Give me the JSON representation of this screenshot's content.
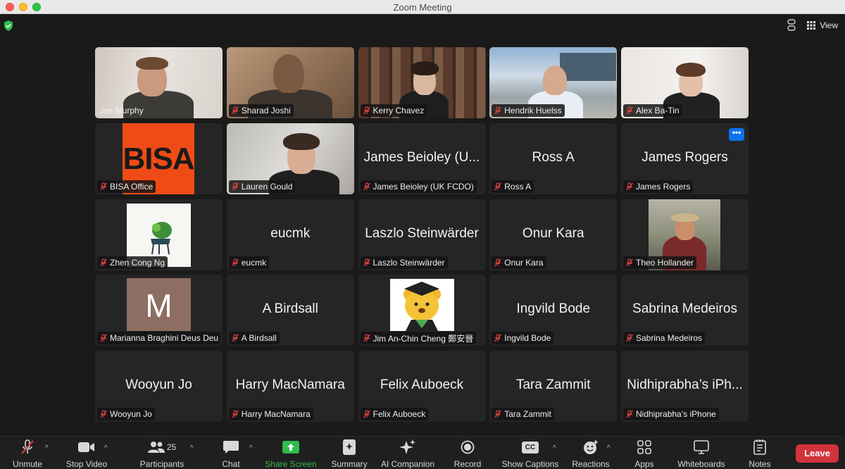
{
  "window": {
    "title": "Zoom Meeting"
  },
  "topbar": {
    "view_label": "View"
  },
  "participants": [
    {
      "label": "Joe Murphy",
      "muted": false,
      "active": true,
      "video": "joe"
    },
    {
      "label": "Sharad Joshi",
      "muted": true,
      "video": "sharad"
    },
    {
      "label": "Kerry Chavez",
      "muted": true,
      "video": "kerry"
    },
    {
      "label": "Hendrik Huelss",
      "muted": true,
      "video": "hendrik"
    },
    {
      "label": "Alex Ba-Tin",
      "muted": true,
      "video": "alex"
    },
    {
      "label": "BISA Office",
      "muted": true,
      "avatar_text": "BISA"
    },
    {
      "label": "Lauren Gould",
      "muted": true,
      "video": "lauren"
    },
    {
      "label": "James Beioley (UK FCDO)",
      "big": "James Beioley (U...",
      "muted": true
    },
    {
      "label": "Ross A",
      "big": "Ross A",
      "muted": true
    },
    {
      "label": "James Rogers",
      "big": "James Rogers",
      "muted": true
    },
    {
      "label": "Zhen Cong Ng",
      "muted": true
    },
    {
      "label": "eucmk",
      "big": "eucmk",
      "muted": true
    },
    {
      "label": "Laszlo Steinwärder",
      "big": "Laszlo Steinwärder",
      "muted": true
    },
    {
      "label": "Onur Kara",
      "big": "Onur Kara",
      "muted": true
    },
    {
      "label": "Theo Hollander",
      "muted": true
    },
    {
      "label": "Marianna Braghini Deus Deu",
      "muted": true,
      "avatar_text": "M"
    },
    {
      "label": "A Birdsall",
      "big": "A Birdsall",
      "muted": true
    },
    {
      "label": "Jim An-Chin Cheng 鄭安晉",
      "muted": true
    },
    {
      "label": "Ingvild Bode",
      "big": "Ingvild Bode",
      "muted": true
    },
    {
      "label": "Sabrina Medeiros",
      "big": "Sabrina Medeiros",
      "muted": true
    },
    {
      "label": "Wooyun Jo",
      "big": "Wooyun Jo",
      "muted": true
    },
    {
      "label": "Harry MacNamara",
      "big": "Harry MacNamara",
      "muted": true
    },
    {
      "label": "Felix Auboeck",
      "big": "Felix Auboeck",
      "muted": true
    },
    {
      "label": "Tara Zammit",
      "big": "Tara Zammit",
      "muted": true
    },
    {
      "label": "Nidhiprabha’s iPhone",
      "big": "Nidhiprabha’s iPh...",
      "muted": true
    }
  ],
  "more_button": "•••",
  "toolbar": {
    "unmute": "Unmute",
    "stop_video": "Stop Video",
    "participants": "Participants",
    "participant_count": "25",
    "chat": "Chat",
    "share_screen": "Share Screen",
    "summary": "Summary",
    "ai_companion": "AI Companion",
    "record": "Record",
    "cc_badge": "CC",
    "show_captions": "Show Captions",
    "reactions": "Reactions",
    "apps": "Apps",
    "whiteboards": "Whiteboards",
    "notes": "Notes",
    "leave": "Leave"
  },
  "colors": {
    "accent_green": "#2fbd4c",
    "leave_red": "#d1343a",
    "more_blue": "#0e72ed",
    "mute_red": "#e0443e"
  }
}
